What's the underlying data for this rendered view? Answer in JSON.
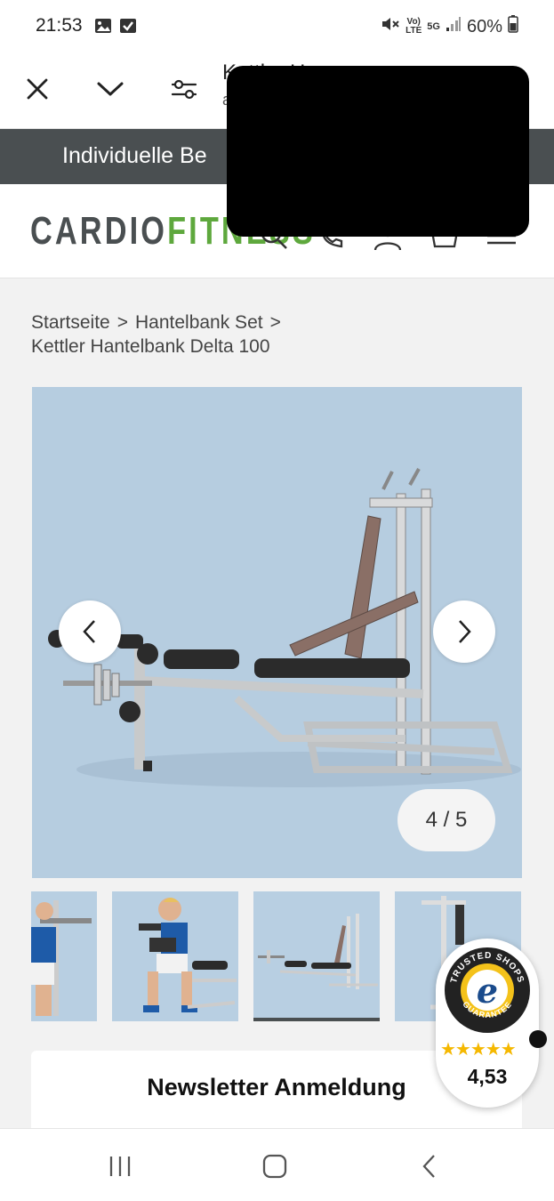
{
  "status_bar": {
    "time": "21:53",
    "battery": "60%",
    "network": "5G",
    "volte": "VoLTE",
    "left_icons": [
      "image-icon",
      "checkbox-icon"
    ],
    "right_icons": [
      "mute-icon",
      "volte-icon",
      "5g-icon",
      "signal-icon",
      "battery-icon"
    ]
  },
  "toolbar": {
    "title": "Kettler H",
    "subtitle": "a",
    "close_icon": "close-icon",
    "collapse_icon": "chevron-down-icon",
    "settings_icon": "filter-settings-icon"
  },
  "promo": {
    "text": "Individuelle Be"
  },
  "header": {
    "logo_part1": "CARDIO",
    "logo_part2": "FITNESS",
    "icons": [
      "search-icon",
      "phone-icon",
      "account-icon",
      "cart-icon",
      "menu-icon"
    ],
    "colors": {
      "logo_gray": "#4a4f51",
      "logo_green": "#5ea83d"
    }
  },
  "breadcrumb": {
    "items": [
      "Startseite",
      "Hantelbank Set",
      "Kettler Hantelbank Delta 100"
    ],
    "separator": ">"
  },
  "gallery": {
    "counter": "4 / 5",
    "prev_icon": "chevron-left-icon",
    "next_icon": "chevron-right-icon"
  },
  "newsletter": {
    "title": "Newsletter Anmeldung"
  },
  "trusted_shops": {
    "label_top": "TRUSTED SHOPS",
    "label_bottom": "GUARANTEE",
    "letter": "e",
    "stars": "★★★★★",
    "rating": "4,53"
  },
  "nav_bar": {
    "items": [
      "recent-apps-icon",
      "home-icon",
      "back-icon"
    ]
  }
}
